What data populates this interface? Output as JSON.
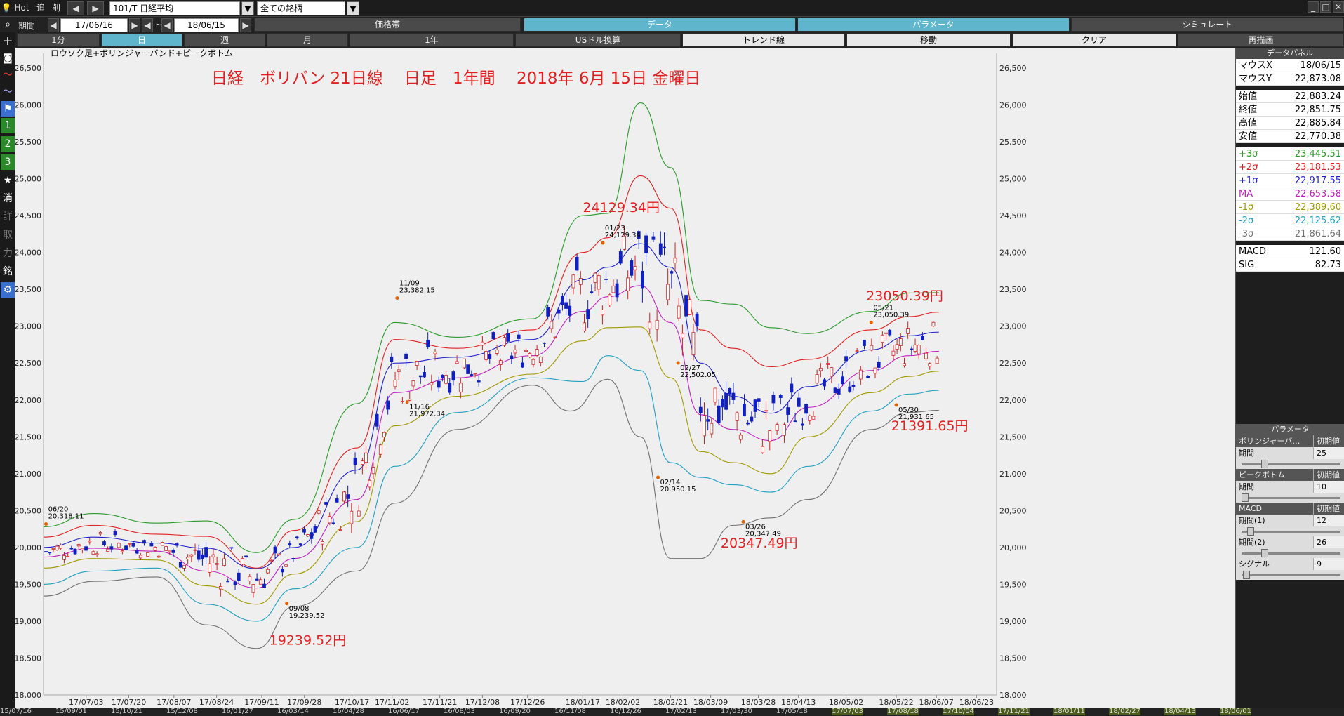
{
  "toolbar": {
    "hot": "Hot",
    "b1": "追",
    "b2": "削",
    "symbol": "101/T 日経平均",
    "filter": "全ての銘柄"
  },
  "period": {
    "label": "期間",
    "from": "17/06/16",
    "sep": "~",
    "to": "18/06/15"
  },
  "row2_tabs": [
    "価格帯",
    "データ",
    "パラメータ",
    "シミュレート"
  ],
  "row3_tabs": [
    "1分",
    "日",
    "週",
    "月",
    "1年",
    "USドル換算",
    "トレンド線",
    "移動",
    "クリア",
    "再描画"
  ],
  "sidebar_icons": [
    "search-icon",
    "crosshair-icon",
    "camera-icon",
    "line-chart-icon",
    "area-chart-icon",
    "flag-icon",
    "one-icon",
    "two-icon",
    "three-icon",
    "star-icon",
    "erase-icon",
    "detail-icon",
    "trade-icon",
    "input-icon",
    "stock-icon",
    "settings-icon"
  ],
  "sidebar_labels": [
    "1",
    "2",
    "3",
    "★",
    "消",
    "詳",
    "取",
    "力",
    "銘",
    "⚙"
  ],
  "chart_title_small": "ロウソク足+ボリンジャーバンド+ピークボトム",
  "chart_title_big": "日経　ボリバン 21日線　 日足　1年間　 2018年 6月 15日 金曜日",
  "data_panel": {
    "title": "データパネル",
    "rows": [
      {
        "k": "マウスX",
        "v": "18/06/15",
        "c": "#000"
      },
      {
        "k": "マウスY",
        "v": "22,873.08",
        "c": "#000"
      },
      {
        "k": "始値",
        "v": "22,883.24",
        "c": "#000"
      },
      {
        "k": "終値",
        "v": "22,851.75",
        "c": "#000"
      },
      {
        "k": "高値",
        "v": "22,885.84",
        "c": "#000"
      },
      {
        "k": "安値",
        "v": "22,770.38",
        "c": "#000"
      },
      {
        "k": "+3σ",
        "v": "23,445.51",
        "c": "#2a9a2a"
      },
      {
        "k": "+2σ",
        "v": "23,181.53",
        "c": "#e02020"
      },
      {
        "k": "+1σ",
        "v": "22,917.55",
        "c": "#2020d0"
      },
      {
        "k": "MA",
        "v": "22,653.58",
        "c": "#c020c0"
      },
      {
        "k": "-1σ",
        "v": "22,389.60",
        "c": "#a09a00"
      },
      {
        "k": "-2σ",
        "v": "22,125.62",
        "c": "#20a0c0"
      },
      {
        "k": "-3σ",
        "v": "21,861.64",
        "c": "#707070"
      },
      {
        "k": "MACD",
        "v": "121.60",
        "c": "#000"
      },
      {
        "k": "SIG",
        "v": "82.73",
        "c": "#000"
      }
    ]
  },
  "params": {
    "title": "パラメータ",
    "reset": "初期値",
    "bb": {
      "head": "ボリンジャーバ…",
      "label": "期間",
      "value": "25"
    },
    "pb": {
      "head": "ピークボトム",
      "label": "期間",
      "value": "10"
    },
    "macd": {
      "head": "MACD",
      "p1_label": "期間(1)",
      "p1": "12",
      "p2_label": "期間(2)",
      "p2": "26",
      "sig_label": "シグナル",
      "sig": "9"
    }
  },
  "timeline_labels": [
    "15/07/16",
    "15/09/01",
    "15/10/21",
    "15/12/08",
    "16/01/27",
    "16/03/14",
    "16/04/28",
    "16/06/17",
    "16/08/03",
    "16/09/20",
    "16/11/08",
    "16/12/26",
    "17/02/13",
    "17/03/30",
    "17/05/18",
    "17/07/03",
    "17/08/18",
    "17/10/04",
    "17/11/21",
    "18/01/11",
    "18/02/27",
    "18/04/13",
    "18/06/01"
  ],
  "chart_data": {
    "type": "line",
    "ylim": [
      18000,
      26700
    ],
    "y_ticks": [
      18000,
      18500,
      19000,
      19500,
      20000,
      20500,
      21000,
      21500,
      22000,
      22500,
      23000,
      23500,
      24000,
      24500,
      25000,
      25500,
      26000,
      26500
    ],
    "x_tick_labels": [
      "17/07/03",
      "17/07/20",
      "17/08/07",
      "17/08/24",
      "17/09/11",
      "17/09/28",
      "17/10/17",
      "17/11/02",
      "17/11/21",
      "17/12/08",
      "17/12/26",
      "18/01/17",
      "18/02/02",
      "18/02/21",
      "18/03/09",
      "18/03/28",
      "18/04/13",
      "18/05/02",
      "18/05/22",
      "18/06/07",
      "18/06/23"
    ],
    "x_ticks_days": [
      17,
      34,
      52,
      69,
      87,
      104,
      123,
      139,
      158,
      175,
      193,
      215,
      231,
      250,
      266,
      285,
      301,
      320,
      340,
      356,
      372
    ],
    "x_range_days": [
      0,
      380
    ],
    "series": [
      {
        "color": "#2a9a2a",
        "points": [
          [
            0,
            20280
          ],
          [
            20,
            20460
          ],
          [
            45,
            20330
          ],
          [
            65,
            20360
          ],
          [
            85,
            19930
          ],
          [
            100,
            20380
          ],
          [
            125,
            21950
          ],
          [
            140,
            23050
          ],
          [
            165,
            22850
          ],
          [
            195,
            23100
          ],
          [
            215,
            24500
          ],
          [
            225,
            24530
          ],
          [
            238,
            26030
          ],
          [
            250,
            25150
          ],
          [
            262,
            23350
          ],
          [
            275,
            23300
          ],
          [
            290,
            22980
          ],
          [
            305,
            22900
          ],
          [
            330,
            23200
          ],
          [
            345,
            23450
          ],
          [
            357,
            23455
          ]
        ]
      },
      {
        "color": "#e02020",
        "points": [
          [
            0,
            20140
          ],
          [
            20,
            20300
          ],
          [
            45,
            20180
          ],
          [
            65,
            20150
          ],
          [
            85,
            19720
          ],
          [
            100,
            20230
          ],
          [
            125,
            21350
          ],
          [
            140,
            22820
          ],
          [
            165,
            22700
          ],
          [
            195,
            22950
          ],
          [
            215,
            24000
          ],
          [
            225,
            24200
          ],
          [
            238,
            25040
          ],
          [
            250,
            24600
          ],
          [
            262,
            22950
          ],
          [
            275,
            22700
          ],
          [
            290,
            22450
          ],
          [
            305,
            22550
          ],
          [
            330,
            22950
          ],
          [
            345,
            23130
          ],
          [
            357,
            23190
          ]
        ]
      },
      {
        "color": "#2020d0",
        "points": [
          [
            0,
            20000
          ],
          [
            20,
            20140
          ],
          [
            45,
            20060
          ],
          [
            65,
            19990
          ],
          [
            85,
            19710
          ],
          [
            100,
            20000
          ],
          [
            125,
            21050
          ],
          [
            140,
            22500
          ],
          [
            165,
            22580
          ],
          [
            195,
            22820
          ],
          [
            215,
            23630
          ],
          [
            225,
            23800
          ],
          [
            238,
            24120
          ],
          [
            250,
            23800
          ],
          [
            262,
            22500
          ],
          [
            275,
            22050
          ],
          [
            290,
            21820
          ],
          [
            305,
            22180
          ],
          [
            330,
            22680
          ],
          [
            345,
            22870
          ],
          [
            357,
            22920
          ]
        ]
      },
      {
        "color": "#c020c0",
        "points": [
          [
            0,
            19870
          ],
          [
            20,
            19990
          ],
          [
            45,
            19950
          ],
          [
            65,
            19680
          ],
          [
            85,
            19450
          ],
          [
            100,
            19850
          ],
          [
            125,
            20650
          ],
          [
            140,
            22100
          ],
          [
            165,
            22300
          ],
          [
            195,
            22600
          ],
          [
            215,
            23200
          ],
          [
            225,
            23400
          ],
          [
            238,
            23550
          ],
          [
            250,
            23050
          ],
          [
            262,
            21800
          ],
          [
            275,
            21600
          ],
          [
            290,
            21450
          ],
          [
            305,
            21900
          ],
          [
            330,
            22400
          ],
          [
            345,
            22600
          ],
          [
            357,
            22660
          ]
        ]
      },
      {
        "color": "#a09a00",
        "points": [
          [
            0,
            19720
          ],
          [
            20,
            19850
          ],
          [
            45,
            19830
          ],
          [
            65,
            19480
          ],
          [
            85,
            19230
          ],
          [
            100,
            19640
          ],
          [
            125,
            20350
          ],
          [
            140,
            21650
          ],
          [
            165,
            22050
          ],
          [
            195,
            22350
          ],
          [
            215,
            22800
          ],
          [
            225,
            22980
          ],
          [
            238,
            22990
          ],
          [
            250,
            22300
          ],
          [
            262,
            21300
          ],
          [
            275,
            21150
          ],
          [
            290,
            21000
          ],
          [
            305,
            21500
          ],
          [
            330,
            22100
          ],
          [
            345,
            22320
          ],
          [
            357,
            22390
          ]
        ]
      },
      {
        "color": "#20a0c0",
        "points": [
          [
            0,
            19500
          ],
          [
            20,
            19680
          ],
          [
            45,
            19720
          ],
          [
            65,
            19230
          ],
          [
            85,
            19000
          ],
          [
            100,
            19440
          ],
          [
            125,
            20000
          ],
          [
            140,
            21100
          ],
          [
            165,
            21830
          ],
          [
            195,
            22300
          ],
          [
            215,
            22250
          ],
          [
            225,
            22600
          ],
          [
            238,
            22400
          ],
          [
            250,
            21150
          ],
          [
            262,
            20950
          ],
          [
            275,
            20850
          ],
          [
            290,
            20750
          ],
          [
            305,
            21100
          ],
          [
            330,
            21850
          ],
          [
            345,
            22080
          ],
          [
            357,
            22130
          ]
        ]
      },
      {
        "color": "#707070",
        "points": [
          [
            0,
            19340
          ],
          [
            20,
            19540
          ],
          [
            45,
            19600
          ],
          [
            65,
            18950
          ],
          [
            85,
            18630
          ],
          [
            100,
            19200
          ],
          [
            125,
            19680
          ],
          [
            140,
            20600
          ],
          [
            165,
            21600
          ],
          [
            195,
            22200
          ],
          [
            210,
            21850
          ],
          [
            225,
            22280
          ],
          [
            238,
            21500
          ],
          [
            250,
            19850
          ],
          [
            262,
            19850
          ],
          [
            275,
            20300
          ],
          [
            290,
            20400
          ],
          [
            305,
            20650
          ],
          [
            330,
            21600
          ],
          [
            345,
            21830
          ],
          [
            357,
            21860
          ]
        ]
      }
    ],
    "annotations": [
      {
        "day": 1,
        "y": 20318.11,
        "date": "06/20",
        "val": "20,318.11"
      },
      {
        "day": 97,
        "y": 19239.52,
        "date": "09/08",
        "val": "19,239.52"
      },
      {
        "day": 141,
        "y": 23382.15,
        "date": "11/09",
        "val": "23,382.15"
      },
      {
        "day": 145,
        "y": 21972.34,
        "date": "11/16",
        "val": "21,972.34"
      },
      {
        "day": 223,
        "y": 24129.34,
        "date": "01/23",
        "val": "24,129.34"
      },
      {
        "day": 245,
        "y": 20950.15,
        "date": "02/14",
        "val": "20,950.15"
      },
      {
        "day": 253,
        "y": 22502.05,
        "date": "02/27",
        "val": "22,502.05"
      },
      {
        "day": 279,
        "y": 20347.49,
        "date": "03/26",
        "val": "20,347.49"
      },
      {
        "day": 330,
        "y": 23050.39,
        "date": "05/21",
        "val": "23,050.39"
      },
      {
        "day": 340,
        "y": 21931.65,
        "date": "05/30",
        "val": "21,931.65"
      }
    ],
    "big_labels": [
      {
        "text": "24129.34円",
        "day": 215,
        "y": 24550
      },
      {
        "text": "19239.52円",
        "day": 90,
        "y": 18680
      },
      {
        "text": "20347.49円",
        "day": 270,
        "y": 20000
      },
      {
        "text": "23050.39円",
        "day": 328,
        "y": 23350
      },
      {
        "text": "21391.65円",
        "day": 338,
        "y": 21590
      }
    ]
  }
}
